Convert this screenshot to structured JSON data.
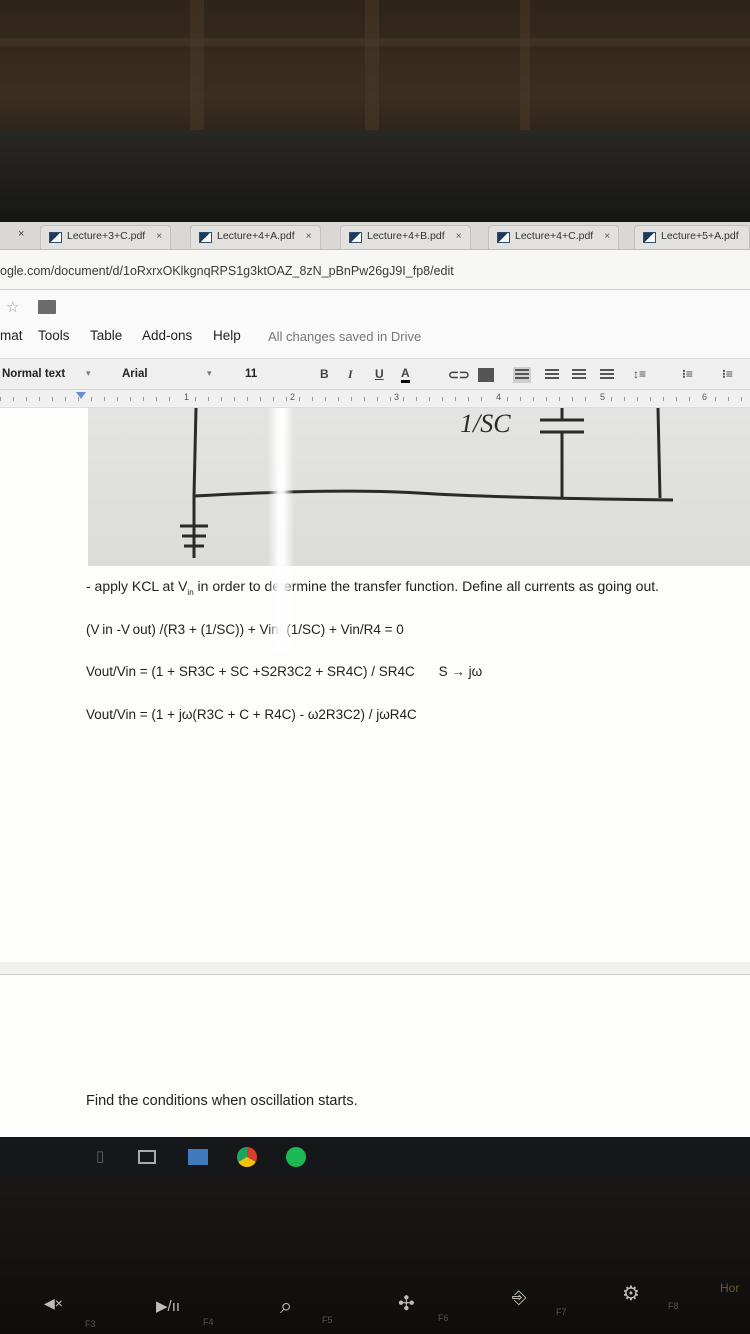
{
  "browser": {
    "tabs": [
      {
        "label": "Lecture+3+C.pdf"
      },
      {
        "label": "Lecture+4+A.pdf"
      },
      {
        "label": "Lecture+4+B.pdf"
      },
      {
        "label": "Lecture+4+C.pdf"
      },
      {
        "label": "Lecture+5+A.pdf"
      }
    ],
    "close_glyph": "×",
    "url": "ogle.com/document/d/1oRxrxOKlkgnqRPS1g3ktOAZ_8zN_pBnPw26gJ9I_fp8/edit"
  },
  "docs": {
    "menu": [
      "mat",
      "Tools",
      "Table",
      "Add-ons",
      "Help"
    ],
    "save_status": "All changes saved in Drive",
    "toolbar": {
      "style": "Normal text",
      "font": "Arial",
      "size": "11",
      "bold": "B",
      "italic": "I",
      "underline": "U",
      "text_color": "A"
    },
    "ruler_numbers": [
      "1",
      "2",
      "3",
      "4",
      "5",
      "6"
    ]
  },
  "document": {
    "figure_label": "1/SC",
    "kcl_line": {
      "prefix": "- apply KCL at V",
      "sub": "in",
      "suffix": " in order to determine the transfer function. Define all currents as going out."
    },
    "eq1": "(V in -V out) /(R3 + (1/SC)) + Vin/ (1/SC) + Vin/R4 = 0",
    "eq2": "Vout/Vin = (1 + SR3C + SC +S2R3C2 + SR4C) / SR4C",
    "eq2_sub": "S → jω",
    "eq3": "Vout/Vin = (1 + jω(R3C + C + R4C) - ω2R3C2) / jωR4C",
    "oscillation": "Find the conditions when oscillation starts."
  },
  "keyboard": {
    "fkeys": [
      "F3",
      "F4",
      "F5",
      "F6",
      "F7",
      "F8"
    ],
    "home": "Hor"
  },
  "colors": {
    "screen_bg": "#f4f3f0",
    "taskbar": "#15171a",
    "chrome_icon": "#d6402b",
    "spotify": "#1db954"
  }
}
